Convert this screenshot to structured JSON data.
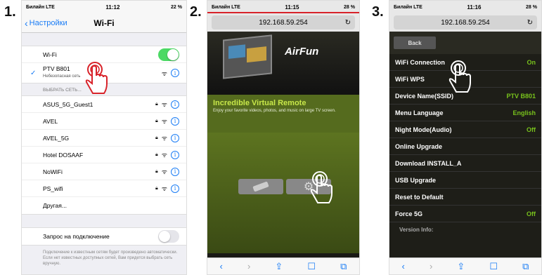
{
  "steps": [
    "1.",
    "2.",
    "3."
  ],
  "phone1": {
    "status": {
      "carrier": "Билайн LTE",
      "time": "11:12",
      "battery": "22 %"
    },
    "nav": {
      "back": "Настройки",
      "title": "Wi-Fi"
    },
    "wifi_label": "Wi-Fi",
    "connected": {
      "name": "PTV B801",
      "sub": "Небезопасная сеть"
    },
    "section": "ВЫБРАТЬ СЕТЬ...",
    "networks": [
      "ASUS_5G_Guest1",
      "AVEL",
      "AVEL_5G",
      "Hotel DOSAAF",
      "NoWiFi",
      "PS_wifi"
    ],
    "other": "Другая...",
    "ask_label": "Запрос на подключение",
    "ask_note": "Подключение к известным сетям будет произведено автоматически. Если нет известных доступных сетей, Вам придется выбрать сеть вручную."
  },
  "phone2": {
    "status": {
      "carrier": "Билайн LTE",
      "time": "11:15",
      "battery": "28 %"
    },
    "url": "192.168.59.254",
    "brand": "AirFun",
    "headline": "Incredible Virtual Remote",
    "tagline": "Enjoy your favorite videos, photos, and music on large TV screen."
  },
  "phone3": {
    "status": {
      "carrier": "Билайн LTE",
      "time": "11:16",
      "battery": "28 %"
    },
    "url": "192.168.59.254",
    "back": "Back",
    "rows": [
      {
        "label": "WiFi Connection",
        "value": "On"
      },
      {
        "label": "WiFi WPS",
        "value": ""
      },
      {
        "label": "Device Name(SSID)",
        "value": "PTV B801"
      },
      {
        "label": "Menu Language",
        "value": "English"
      },
      {
        "label": "Night Mode(Audio)",
        "value": "Off"
      },
      {
        "label": "Online Upgrade",
        "value": ""
      },
      {
        "label": "Download INSTALL_A",
        "value": ""
      },
      {
        "label": "USB Upgrade",
        "value": ""
      },
      {
        "label": "Reset to Default",
        "value": ""
      },
      {
        "label": "Force 5G",
        "value": "Off"
      }
    ],
    "version": "Version Info:"
  },
  "colors": {
    "accent": "#1a7cf5",
    "toggle_on": "#4cd964",
    "value_green": "#78c21c",
    "highlight": "#d8232a"
  }
}
